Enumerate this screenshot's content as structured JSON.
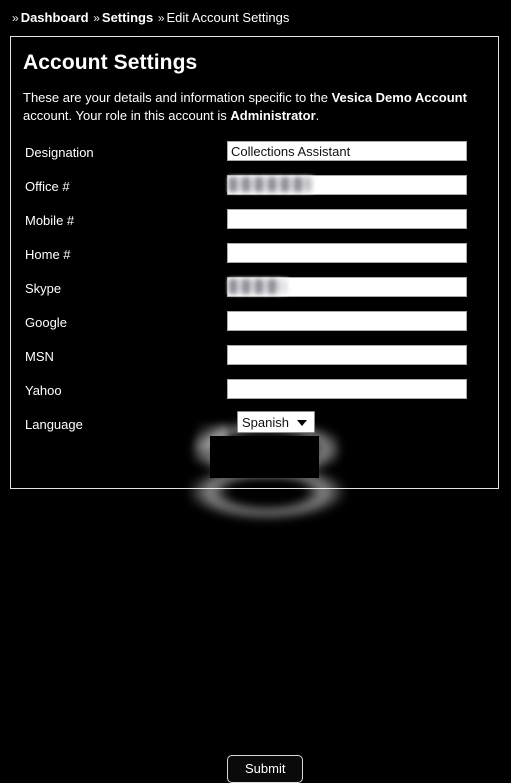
{
  "breadcrumb": {
    "separator": "»",
    "items": [
      {
        "label": "Dashboard",
        "type": "link"
      },
      {
        "label": "Settings",
        "type": "link"
      },
      {
        "label": "Edit Account Settings",
        "type": "current"
      }
    ]
  },
  "panel": {
    "title": "Account Settings",
    "description_part1": "These are your details and information specific to the ",
    "description_account": "Vesica Demo Account",
    "description_part2": " account. Your role in this account is ",
    "description_role": "Administrator",
    "description_part3": "."
  },
  "form": {
    "fields": [
      {
        "label": "Designation",
        "value": "Collections Assistant",
        "placeholder": "",
        "control": "text",
        "redacted": false
      },
      {
        "label": "Office #",
        "value": "",
        "placeholder": "",
        "control": "text",
        "redacted": true
      },
      {
        "label": "Mobile #",
        "value": "",
        "placeholder": "",
        "control": "text",
        "redacted": false
      },
      {
        "label": "Home #",
        "value": "",
        "placeholder": "",
        "control": "text",
        "redacted": false
      },
      {
        "label": "Skype",
        "value": "",
        "placeholder": "",
        "control": "text",
        "redacted": true
      },
      {
        "label": "Google",
        "value": "",
        "placeholder": "",
        "control": "text",
        "redacted": false
      },
      {
        "label": "MSN",
        "value": "",
        "placeholder": "",
        "control": "text",
        "redacted": false
      },
      {
        "label": "Yahoo",
        "value": "",
        "placeholder": "",
        "control": "text",
        "redacted": false
      },
      {
        "label": "Language",
        "value": "Spanish",
        "placeholder": "",
        "control": "select",
        "redacted": false
      }
    ],
    "language_selected": "Spanish",
    "language_options": [
      "Spanish"
    ],
    "submit_label": "Submit"
  },
  "icons": {
    "select_arrow": "chevron-down-icon"
  },
  "colors": {
    "background": "#000000",
    "text": "#ffffff",
    "panel_border": "#e2e2e2",
    "input_background": "#ffffff",
    "input_text": "#111111",
    "highlight_glow": "#ffffff"
  }
}
